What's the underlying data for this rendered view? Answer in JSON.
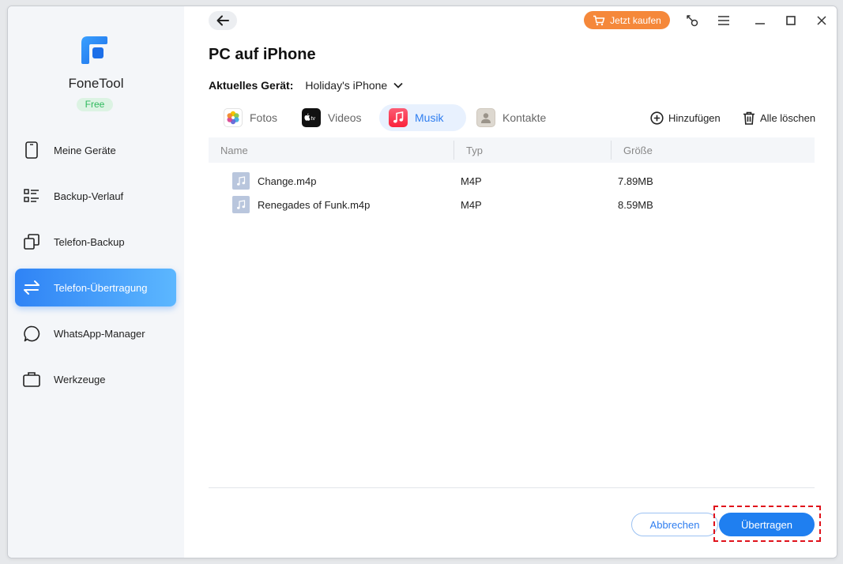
{
  "app": {
    "name": "FoneTool",
    "badge": "Free"
  },
  "sidebar": {
    "items": [
      {
        "label": "Meine Geräte",
        "icon": "phone-icon"
      },
      {
        "label": "Backup-Verlauf",
        "icon": "list-icon"
      },
      {
        "label": "Telefon-Backup",
        "icon": "copy-icon"
      },
      {
        "label": "Telefon-Übertragung",
        "icon": "transfer-icon",
        "active": true
      },
      {
        "label": "WhatsApp-Manager",
        "icon": "chat-icon"
      },
      {
        "label": "Werkzeuge",
        "icon": "toolbox-icon"
      }
    ]
  },
  "titlebar": {
    "buy_label": "Jetzt kaufen"
  },
  "page": {
    "title": "PC auf iPhone",
    "device_label": "Aktuelles Gerät:",
    "device_value": "Holiday's iPhone"
  },
  "tabs": [
    {
      "label": "Fotos",
      "icon": "photos-icon"
    },
    {
      "label": "Videos",
      "icon": "appletv-icon"
    },
    {
      "label": "Musik",
      "icon": "music-icon",
      "active": true
    },
    {
      "label": "Kontakte",
      "icon": "contacts-icon"
    }
  ],
  "actions": {
    "add_label": "Hinzufügen",
    "clear_label": "Alle löschen"
  },
  "table": {
    "columns": [
      "Name",
      "Typ",
      "Größe"
    ],
    "rows": [
      {
        "name": "Change.m4p",
        "type": "M4P",
        "size": "7.89MB"
      },
      {
        "name": "Renegades of Funk.m4p",
        "type": "M4P",
        "size": "8.59MB"
      }
    ]
  },
  "footer": {
    "cancel_label": "Abbrechen",
    "transfer_label": "Übertragen"
  },
  "colors": {
    "accent": "#1f7ff0",
    "buy": "#f5883a",
    "highlight": "#e0121b",
    "free": "#2eb85c"
  }
}
